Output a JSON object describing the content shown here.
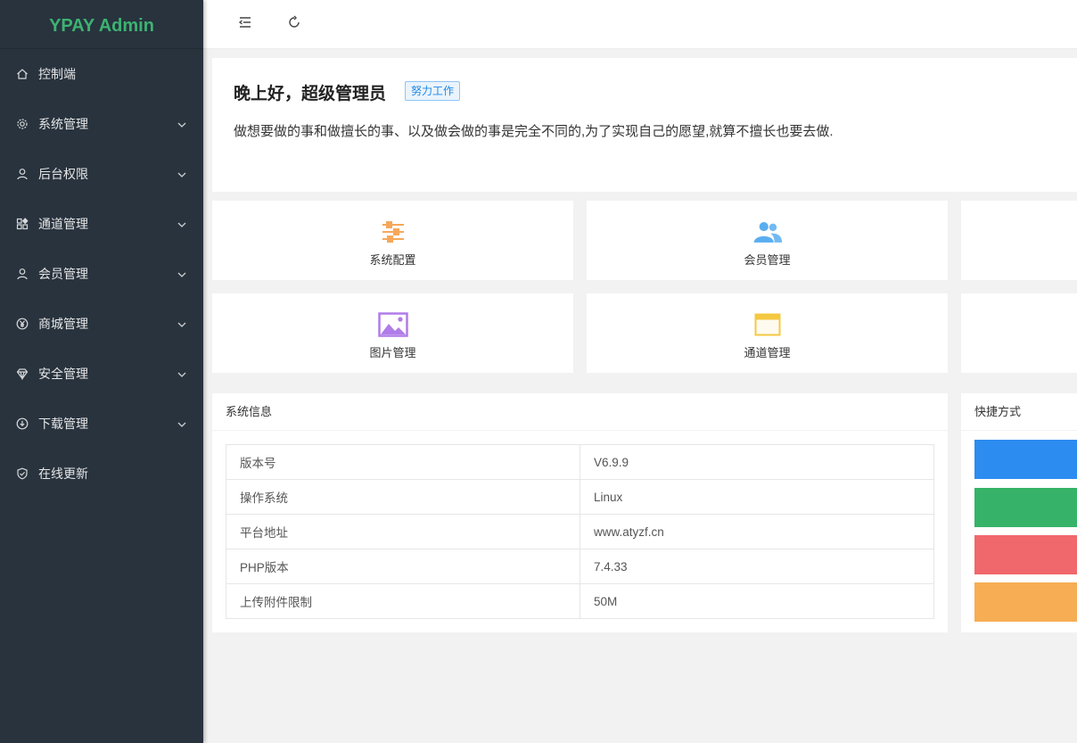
{
  "app": {
    "logo": "YPAY Admin"
  },
  "sidebar": {
    "items": [
      {
        "label": "控制端",
        "icon": "home-icon",
        "has_children": false
      },
      {
        "label": "系统管理",
        "icon": "gear-icon",
        "has_children": true
      },
      {
        "label": "后台权限",
        "icon": "user-icon",
        "has_children": true
      },
      {
        "label": "通道管理",
        "icon": "apps-icon",
        "has_children": true
      },
      {
        "label": "会员管理",
        "icon": "user-icon",
        "has_children": true
      },
      {
        "label": "商城管理",
        "icon": "yen-icon",
        "has_children": true
      },
      {
        "label": "安全管理",
        "icon": "diamond-icon",
        "has_children": true
      },
      {
        "label": "下载管理",
        "icon": "download-icon",
        "has_children": true
      },
      {
        "label": "在线更新",
        "icon": "shield-check-icon",
        "has_children": false
      }
    ]
  },
  "topbar": {
    "toggle_icon": "menu-fold-icon",
    "refresh_icon": "refresh-icon"
  },
  "greeting": {
    "title": "晚上好，超级管理员",
    "badge": "努力工作",
    "message": "做想要做的事和做擅长的事、以及做会做的事是完全不同的,为了实现自己的愿望,就算不擅长也要去做."
  },
  "tiles": [
    {
      "label": "系统配置",
      "icon": "sliders-icon",
      "color": "#f6a85a"
    },
    {
      "label": "会员管理",
      "icon": "users-icon",
      "color": "#5aaef0"
    },
    {
      "label": "图片管理",
      "icon": "image-icon",
      "color": "#b07ce8"
    },
    {
      "label": "通道管理",
      "icon": "window-icon",
      "color": "#f5c842"
    }
  ],
  "system_info": {
    "title": "系统信息",
    "rows": [
      {
        "key": "版本号",
        "value": "V6.9.9"
      },
      {
        "key": "操作系统",
        "value": "Linux"
      },
      {
        "key": "平台地址",
        "value": "www.atyzf.cn"
      },
      {
        "key": "PHP版本",
        "value": "7.4.33"
      },
      {
        "key": "上传附件限制",
        "value": "50M"
      }
    ]
  },
  "shortcuts": {
    "title": "快捷方式",
    "buttons": [
      {
        "color": "#2d8cf0"
      },
      {
        "color": "#36b368"
      },
      {
        "color": "#f0686b"
      },
      {
        "color": "#f7ad54"
      }
    ]
  }
}
